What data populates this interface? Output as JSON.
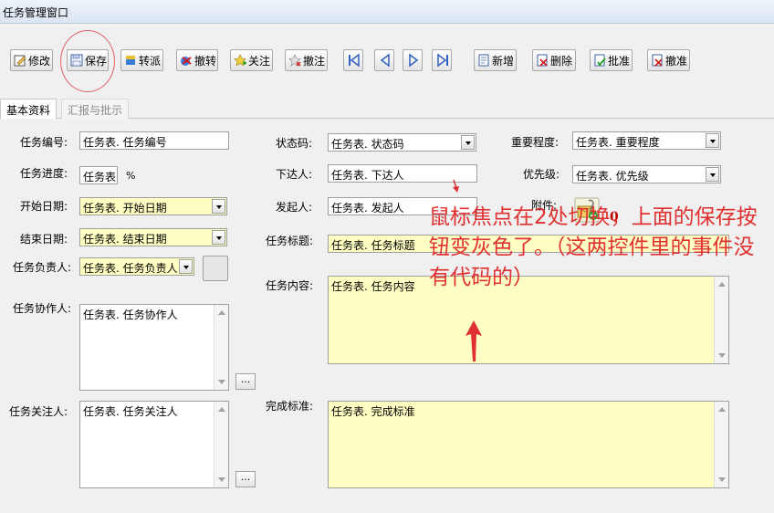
{
  "window": {
    "title": "任务管理窗口"
  },
  "toolbar": {
    "edit_label": "修改",
    "save_label": "保存",
    "transfer_label": "转派",
    "recall_label": "撤转",
    "follow_label": "关注",
    "unfollow_label": "撤注",
    "new_label": "新增",
    "delete_label": "删除",
    "approve_label": "批准",
    "unapprove_label": "撤准"
  },
  "tabs": [
    {
      "label": "基本资料",
      "active": true
    },
    {
      "label": "汇报与批示",
      "active": false
    }
  ],
  "form": {
    "task_no": {
      "label": "任务编号:",
      "value": "任务表. 任务编号"
    },
    "progress": {
      "label": "任务进度:",
      "value": "任务表",
      "unit": "%"
    },
    "start_date": {
      "label": "开始日期:",
      "value": "任务表. 开始日期"
    },
    "end_date": {
      "label": "结束日期:",
      "value": "任务表. 结束日期"
    },
    "owner": {
      "label": "任务负责人:",
      "value": "任务表. 任务负责人"
    },
    "collaborators": {
      "label": "任务协作人:",
      "value": "任务表. 任务协作人"
    },
    "followers": {
      "label": "任务关注人:",
      "value": "任务表. 任务关注人"
    },
    "status": {
      "label": "状态码:",
      "value": "任务表. 状态码"
    },
    "assigner": {
      "label": "下达人:",
      "value": "任务表. 下达人"
    },
    "initiator": {
      "label": "发起人:",
      "value": "任务表. 发起人"
    },
    "title": {
      "label": "任务标题:",
      "value": "任务表. 任务标题"
    },
    "content": {
      "label": "任务内容:",
      "value": "任务表. 任务内容"
    },
    "criteria": {
      "label": "完成标准:",
      "value": "任务表. 完成标准"
    },
    "importance": {
      "label": "重要程度:",
      "value": "任务表. 重要程度"
    },
    "priority": {
      "label": "优先级:",
      "value": "任务表. 优先级"
    },
    "attachment": {
      "label": "附件:",
      "count": "0"
    },
    "ellipsis_label": "..."
  },
  "annotation": {
    "text": "鼠标焦点在2处切换，上面的保存按钮变灰色了。（这两控件里的事件没有代码的）",
    "color": "#e03030"
  },
  "colors": {
    "field_yellow": "#ffffc4",
    "titlebar": "#dbe6f4"
  }
}
